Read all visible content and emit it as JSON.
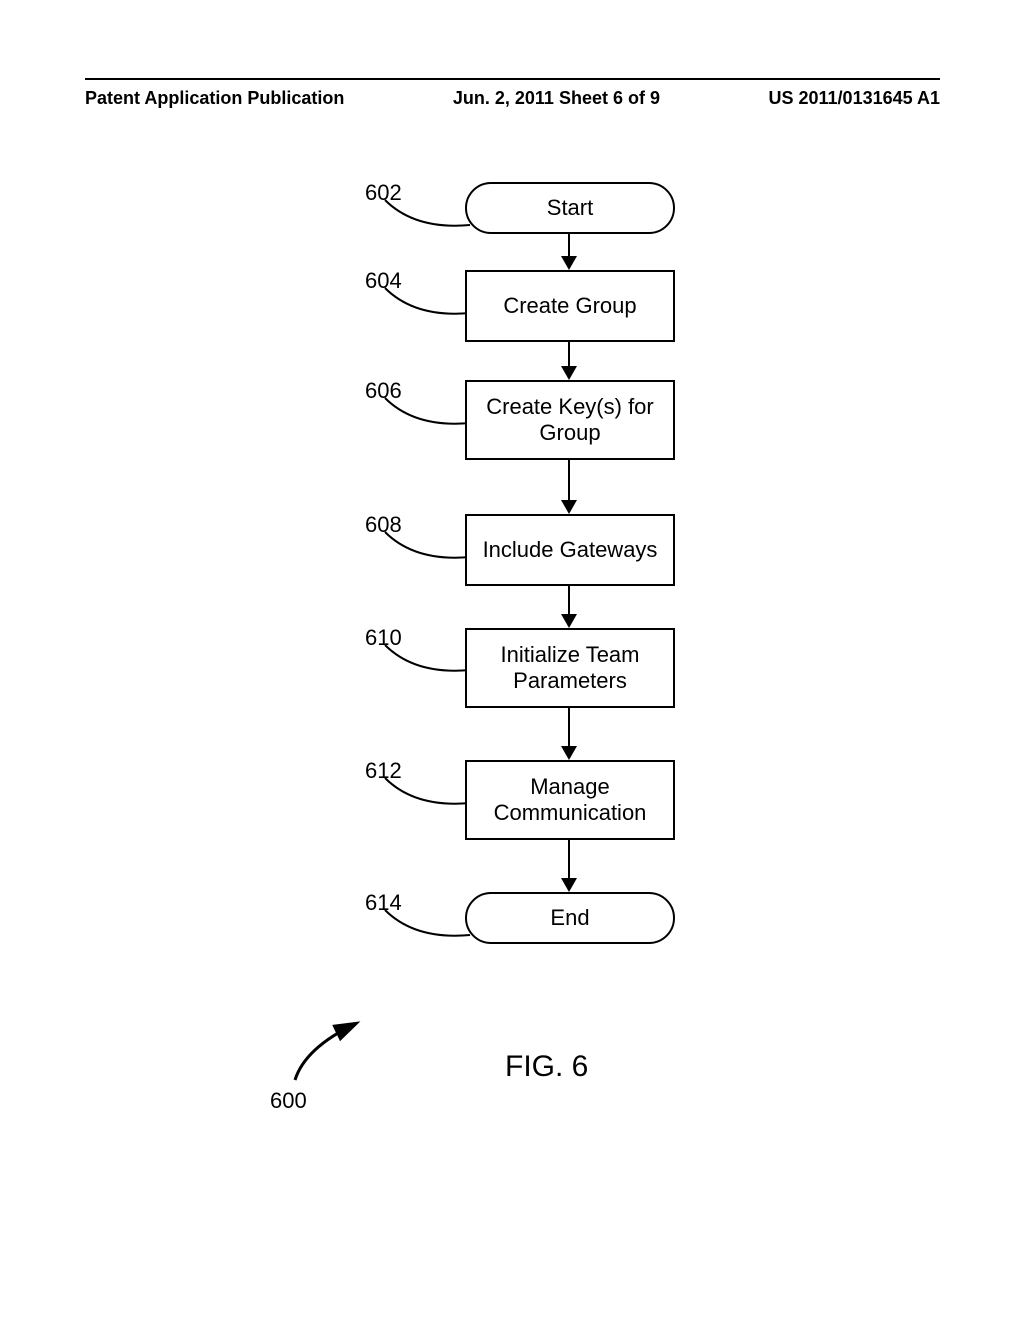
{
  "header": {
    "left": "Patent Application Publication",
    "center": "Jun. 2, 2011  Sheet 6 of 9",
    "right": "US 2011/0131645 A1"
  },
  "flow": {
    "ref_overall": "600",
    "labels": {
      "n602": "602",
      "n604": "604",
      "n606": "606",
      "n608": "608",
      "n610": "610",
      "n612": "612",
      "n614": "614"
    },
    "nodes": {
      "start": "Start",
      "create_group": "Create Group",
      "create_keys": "Create Key(s) for Group",
      "include_gateways": "Include Gateways",
      "initialize_team": "Initialize Team Parameters",
      "manage_comm": "Manage Communication",
      "end": "End"
    },
    "caption": "FIG. 6"
  }
}
